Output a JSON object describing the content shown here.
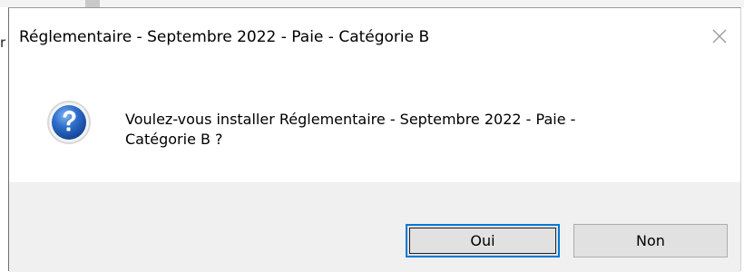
{
  "dialog": {
    "title": "Réglementaire - Septembre 2022 - Paie - Catégorie B",
    "close_icon": "close-icon",
    "icon": "question-icon",
    "message_line1": "Voulez-vous installer Réglementaire - Septembre 2022 - Paie -",
    "message_line2": "Catégorie B  ?",
    "buttons": {
      "yes_label": "Oui",
      "no_label": "Non"
    }
  },
  "background": {
    "left_glyph": "r"
  },
  "colors": {
    "focus_accent": "#0078d7",
    "footer_bg": "#f0f0f0",
    "button_bg": "#e1e1e1",
    "icon_blue": "#1f5fb6"
  }
}
